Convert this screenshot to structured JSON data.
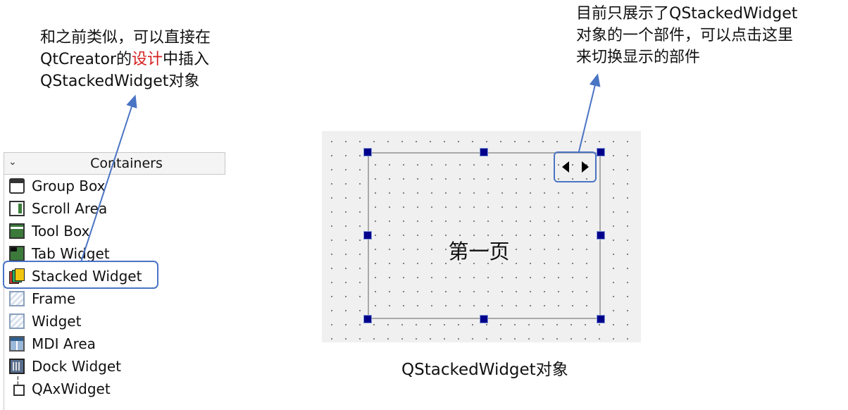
{
  "callouts": {
    "left": {
      "line1": "和之前类似，可以直接在",
      "line2_pre": "QtCreator的",
      "line2_red": "设计",
      "line2_post": "中插入",
      "line3": "QStackedWidget对象"
    },
    "right": {
      "line1": "目前只展示了QStackedWidget",
      "line2": "对象的一个部件，可以点击这里",
      "line3": "来切换显示的部件"
    }
  },
  "widget_box": {
    "category": "Containers",
    "items": [
      {
        "label": "Group Box",
        "icon": "group-box-icon"
      },
      {
        "label": "Scroll Area",
        "icon": "scroll-area-icon"
      },
      {
        "label": "Tool Box",
        "icon": "tool-box-icon"
      },
      {
        "label": "Tab Widget",
        "icon": "tab-widget-icon"
      },
      {
        "label": "Stacked Widget",
        "icon": "stacked-widget-icon"
      },
      {
        "label": "Frame",
        "icon": "frame-icon"
      },
      {
        "label": "Widget",
        "icon": "widget-icon"
      },
      {
        "label": "MDI Area",
        "icon": "mdi-area-icon"
      },
      {
        "label": "Dock Widget",
        "icon": "dock-widget-icon"
      },
      {
        "label": "QAxWidget",
        "icon": "qaxwidget-icon"
      }
    ]
  },
  "canvas": {
    "page_label": "第一页",
    "caption": "QStackedWidget对象"
  },
  "colors": {
    "highlight": "#4a74c4",
    "emphasis_text": "#d42020",
    "selection_handle": "#00008b"
  }
}
